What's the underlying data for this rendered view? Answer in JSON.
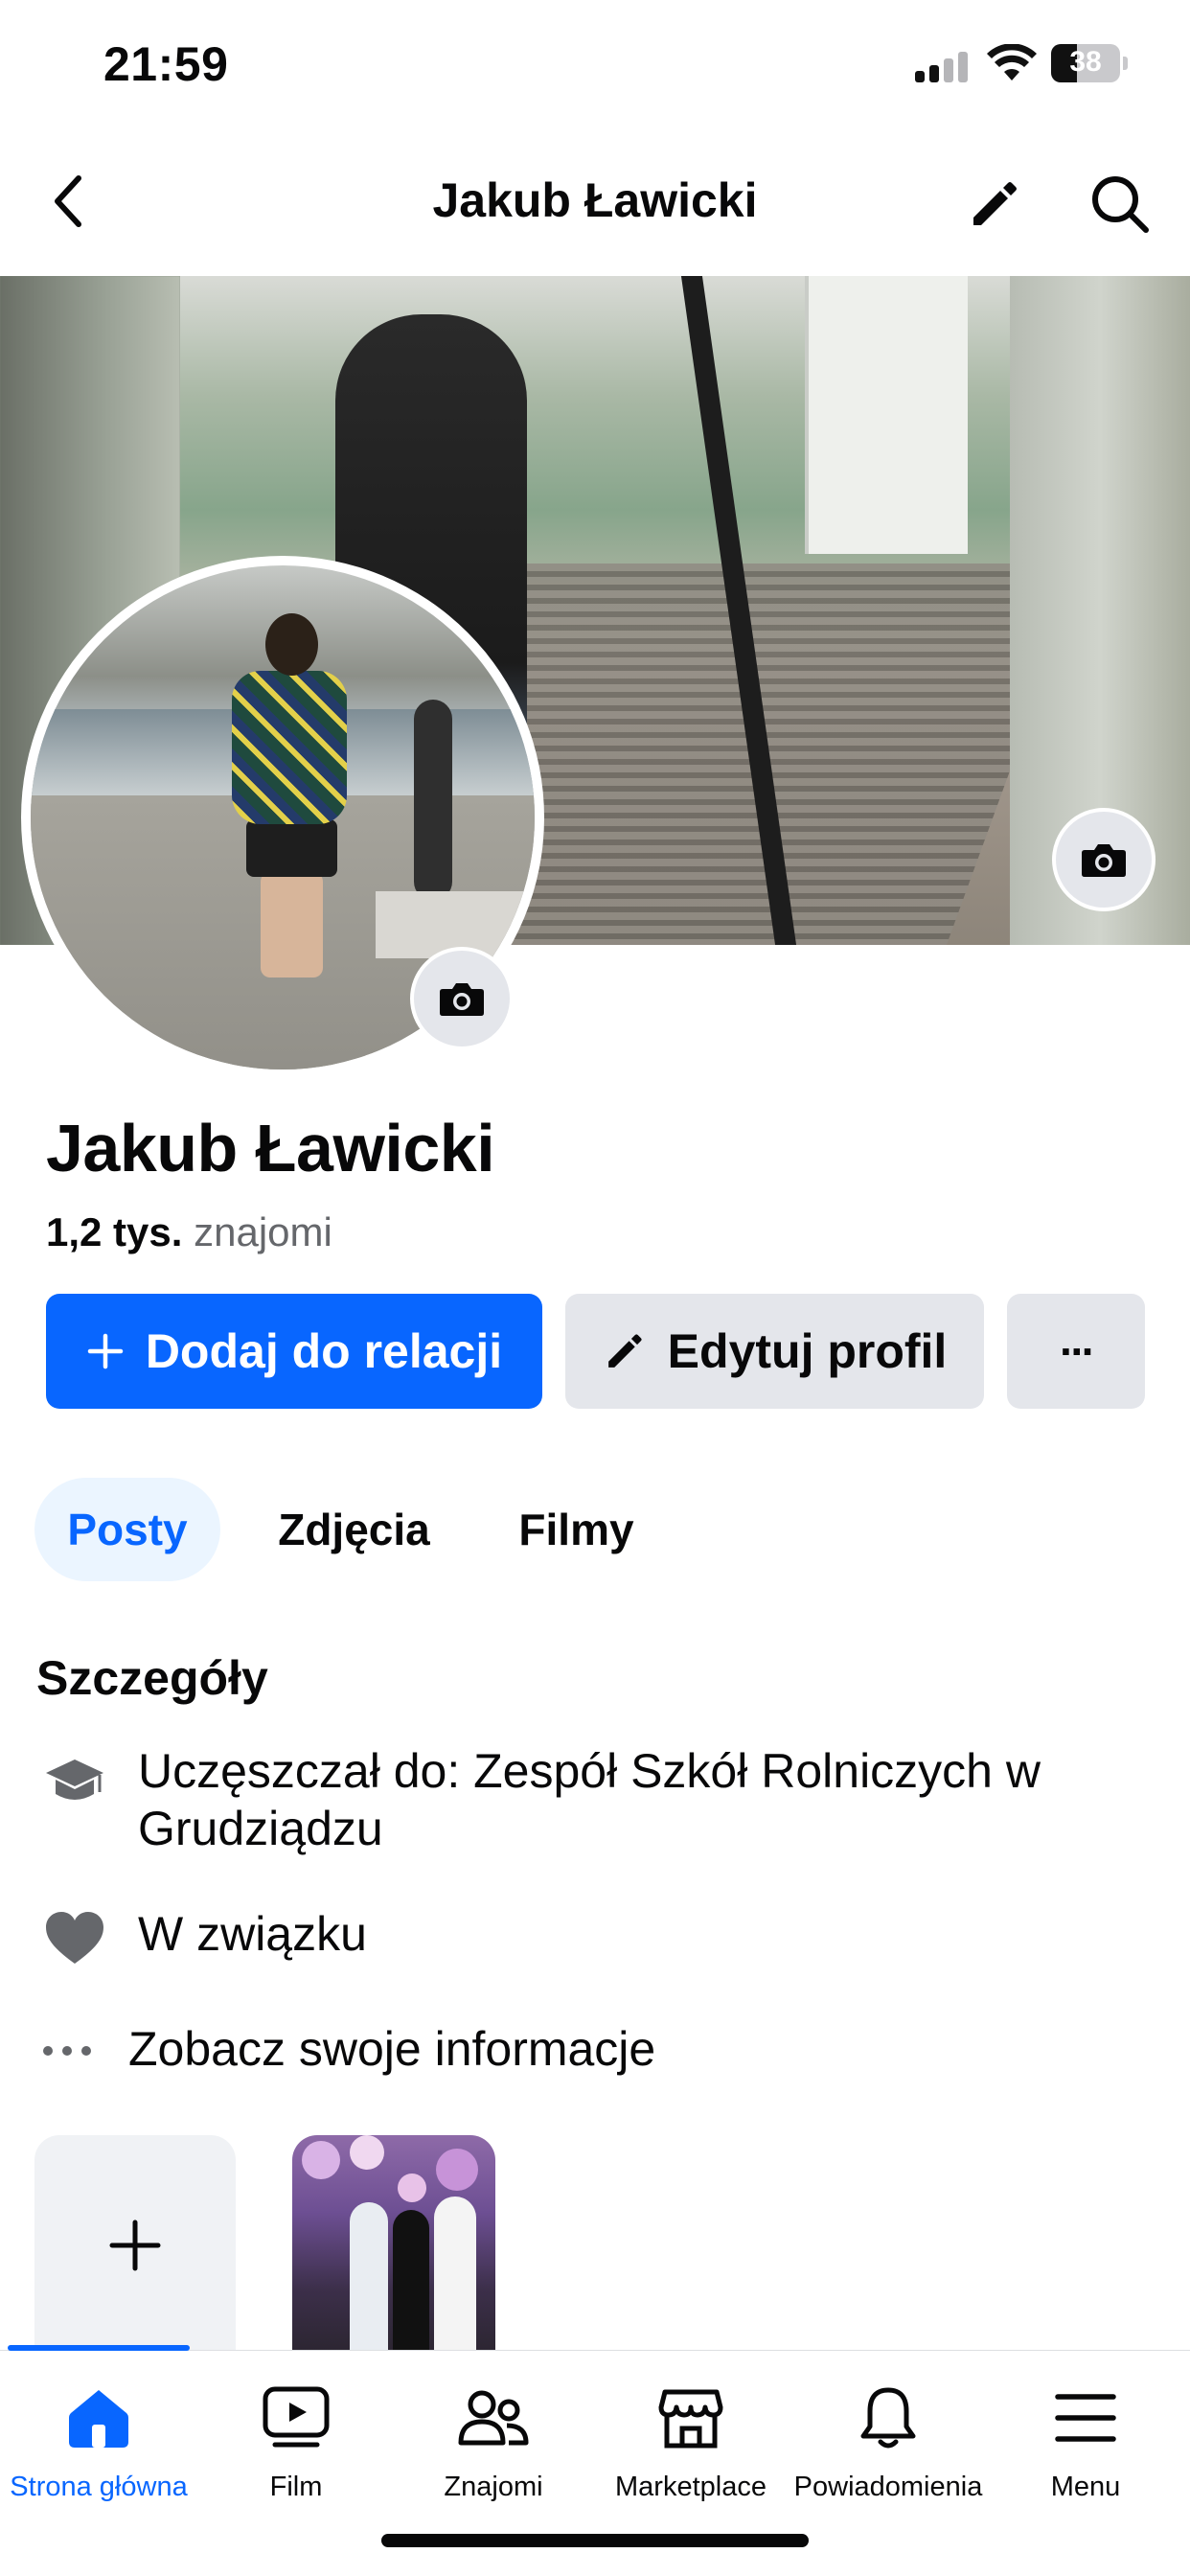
{
  "status_bar": {
    "time": "21:59",
    "battery_level": "38",
    "icons": [
      "signal-icon",
      "wifi-icon",
      "battery-icon"
    ]
  },
  "header": {
    "title": "Jakub Ławicki",
    "back_icon": "chevron-left-icon",
    "edit_icon": "pencil-icon",
    "search_icon": "search-icon"
  },
  "profile": {
    "name": "Jakub Ławicki",
    "friends_count": "1,2 tys.",
    "friends_label": "znajomi"
  },
  "actions": {
    "add_story": "Dodaj do relacji",
    "edit_profile": "Edytuj profil",
    "more": "···"
  },
  "tabs": [
    {
      "label": "Posty",
      "active": true
    },
    {
      "label": "Zdjęcia",
      "active": false
    },
    {
      "label": "Filmy",
      "active": false
    }
  ],
  "details": {
    "title": "Szczegóły",
    "items": [
      {
        "icon": "graduation-cap-icon",
        "text": "Uczęszczał do: Zespół Szkół Rolniczych w Grudziądzu"
      },
      {
        "icon": "heart-icon",
        "text": "W związku"
      },
      {
        "icon": "more-dots-icon",
        "text": "Zobacz swoje informacje"
      }
    ]
  },
  "tabbar": {
    "items": [
      {
        "label": "Strona główna",
        "icon": "home-icon",
        "active": true
      },
      {
        "label": "Film",
        "icon": "video-icon",
        "active": false
      },
      {
        "label": "Znajomi",
        "icon": "friends-icon",
        "active": false
      },
      {
        "label": "Marketplace",
        "icon": "marketplace-icon",
        "active": false
      },
      {
        "label": "Powiadomienia",
        "icon": "bell-icon",
        "active": false
      },
      {
        "label": "Menu",
        "icon": "menu-icon",
        "active": false
      }
    ]
  },
  "colors": {
    "accent": "#0866ff",
    "accent_light": "#ebf5ff",
    "secondary_button": "#e4e6eb",
    "text_primary": "#080809",
    "text_secondary": "#65676b"
  }
}
